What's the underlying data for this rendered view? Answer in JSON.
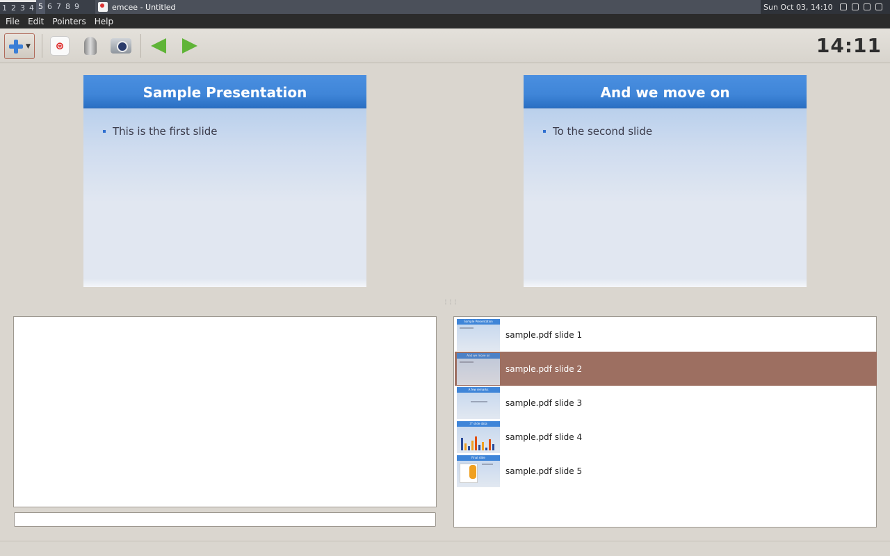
{
  "system": {
    "workspaces": [
      "1",
      "2",
      "3",
      "4",
      "5",
      "6",
      "7",
      "8",
      "9"
    ],
    "active_workspace": "5",
    "window_title": "emcee - Untitled",
    "datetime": "Sun Oct 03, 14:10"
  },
  "menu": [
    "File",
    "Edit",
    "Pointers",
    "Help"
  ],
  "toolbar": {
    "timer": "14:11"
  },
  "current_slide": {
    "title": "Sample Presentation",
    "bullet": "This is the first slide"
  },
  "next_slide": {
    "title": "And we move on",
    "bullet": "To the second slide"
  },
  "slide_list": {
    "items": [
      {
        "label": "sample.pdf slide 1",
        "thumb_title": "Sample Presentation",
        "selected": false
      },
      {
        "label": "sample.pdf slide 2",
        "thumb_title": "And we move on",
        "selected": true
      },
      {
        "label": "sample.pdf slide 3",
        "thumb_title": "A few remarks",
        "selected": false
      },
      {
        "label": "sample.pdf slide 4",
        "thumb_title": "3\" slide data",
        "selected": false
      },
      {
        "label": "sample.pdf slide 5",
        "thumb_title": "Final slide",
        "selected": false
      }
    ]
  },
  "colors": {
    "selection": "#9d6f61",
    "slide_header": "#3f85d8",
    "nav_arrow": "#5fb437"
  }
}
